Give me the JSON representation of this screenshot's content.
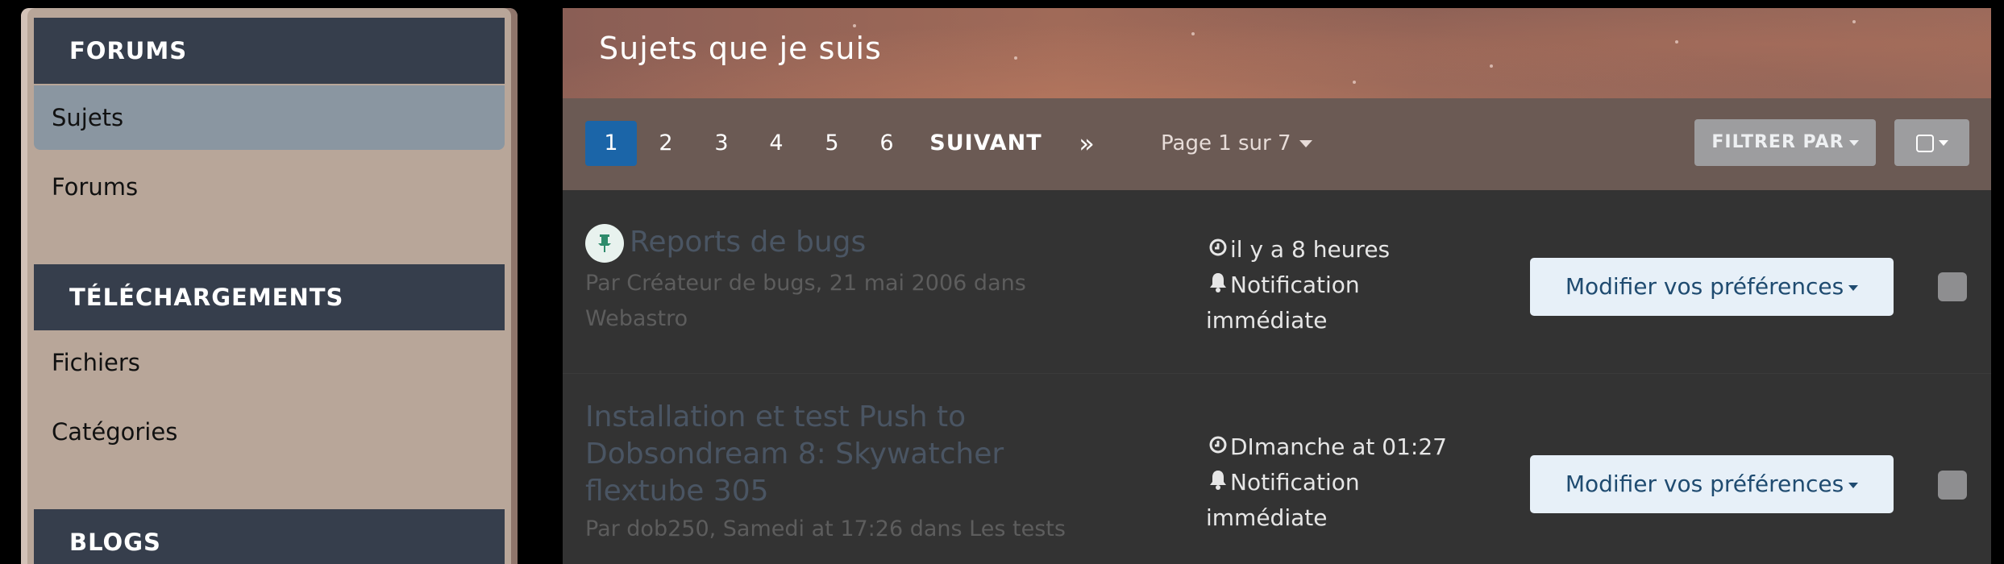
{
  "sidebar": {
    "sections": [
      {
        "header": "FORUMS",
        "items": [
          "Sujets",
          "Forums"
        ]
      },
      {
        "header": "TÉLÉCHARGEMENTS",
        "items": [
          "Fichiers",
          "Catégories"
        ]
      },
      {
        "header": "BLOGS",
        "items": []
      }
    ],
    "active_item": "Sujets"
  },
  "header": {
    "title": "Sujets que je suis"
  },
  "pagination": {
    "pages": [
      "1",
      "2",
      "3",
      "4",
      "5",
      "6"
    ],
    "current": "1",
    "next_label": "SUIVANT",
    "last_label": "»",
    "page_of": "Page 1 sur 7"
  },
  "toolbar": {
    "filter_label": "FILTRER PAR"
  },
  "topics": [
    {
      "title": "Reports de bugs",
      "meta_line1": "Par Créateur de bugs, 21 mai 2006 dans",
      "meta_line2": "Webastro",
      "time": "il y a 8 heures",
      "notif_line1": "Notification",
      "notif_line2": "immédiate",
      "button": "Modifier vos préférences",
      "pinned": true
    },
    {
      "title_line1": "Installation et test Push to",
      "title_line2": "Dobsondream 8: Skywatcher",
      "title_line3": "flextube 305",
      "meta_line1": "Par dob250, Samedi at 17:26 dans Les tests",
      "time": "DImanche at 01:27",
      "notif_line1": "Notification",
      "notif_line2": "immédiate",
      "button": "Modifier vos préférences",
      "pinned": false
    }
  ],
  "colors": {
    "accent": "#1b65a8",
    "sidebar_header": "#363e4c",
    "sidebar_bg": "#b8a699",
    "active_item": "#8a96a1"
  },
  "icons": {
    "pin": "pin-icon",
    "clock": "clock-icon",
    "bell": "bell-icon"
  }
}
